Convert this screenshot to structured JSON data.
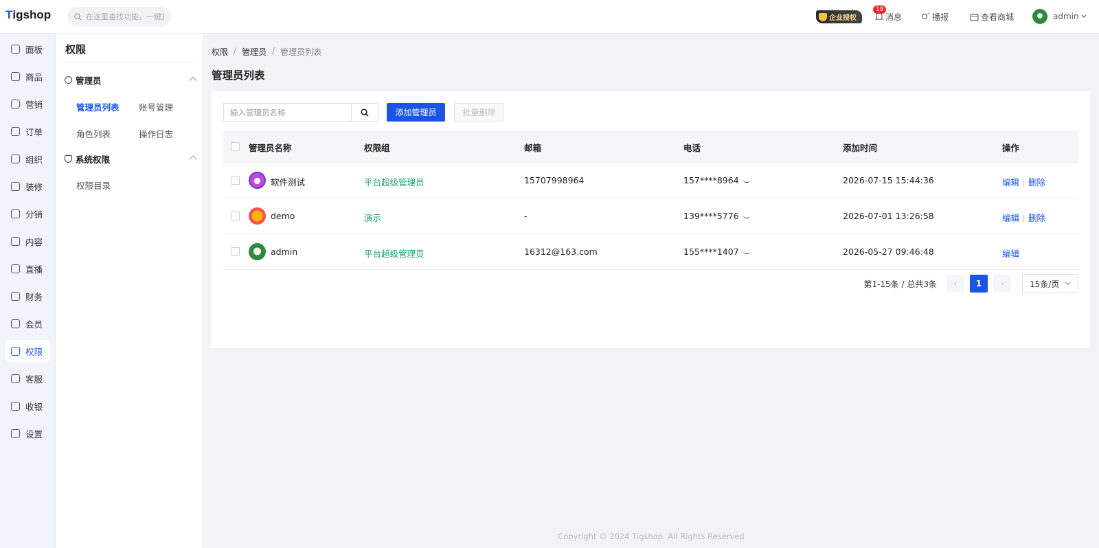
{
  "app": {
    "logo": "Tigshop",
    "search_placeholder": "在这里查找功能，一键直达"
  },
  "header": {
    "auth_badge": "企业授权",
    "notice_count": "19",
    "notice_label": "消息",
    "broadcast_label": "播报",
    "shop_label": "查看商城",
    "user": "admin"
  },
  "sidebar": {
    "items": [
      {
        "label": "面板",
        "icon": "chart-icon"
      },
      {
        "label": "商品",
        "icon": "box-icon"
      },
      {
        "label": "营销",
        "icon": "marketing-icon"
      },
      {
        "label": "订单",
        "icon": "order-icon"
      },
      {
        "label": "组织",
        "icon": "org-icon"
      },
      {
        "label": "装修",
        "icon": "decorate-icon"
      },
      {
        "label": "分销",
        "icon": "distribution-icon"
      },
      {
        "label": "内容",
        "icon": "content-icon"
      },
      {
        "label": "直播",
        "icon": "live-icon"
      },
      {
        "label": "财务",
        "icon": "finance-icon"
      },
      {
        "label": "会员",
        "icon": "member-icon"
      },
      {
        "label": "权限",
        "icon": "shield-icon"
      },
      {
        "label": "客服",
        "icon": "service-icon"
      },
      {
        "label": "收银",
        "icon": "cashier-icon"
      },
      {
        "label": "设置",
        "icon": "settings-icon"
      }
    ],
    "active": "权限"
  },
  "subnav": {
    "title": "权限",
    "groups": [
      {
        "label": "管理员",
        "links": [
          "管理员列表",
          "账号管理",
          "角色列表",
          "操作日志"
        ]
      },
      {
        "label": "系统权限",
        "links": [
          "权限目录"
        ]
      }
    ]
  },
  "breadcrumb": [
    "权限",
    "管理员",
    "管理员列表"
  ],
  "page_title": "管理员列表",
  "filter": {
    "placeholder": "输入管理员名称",
    "add_label": "添加管理员",
    "batch_delete_label": "批量删除"
  },
  "table": {
    "headers": [
      "管理员名称",
      "权限组",
      "邮箱",
      "电话",
      "添加时间",
      "操作"
    ],
    "rows": [
      {
        "name": "软件测试",
        "group": "平台超级管理员",
        "email": "15707998964",
        "phone": "157****8964",
        "time": "2026-07-15 15:44:36",
        "edit": "编辑",
        "delete": "删除"
      },
      {
        "name": "demo",
        "group": "演示",
        "email": "-",
        "phone": "139****5776",
        "time": "2026-07-01 13:26:58",
        "edit": "编辑",
        "delete": "删除"
      },
      {
        "name": "admin",
        "group": "平台超级管理员",
        "email": "16312@163.com",
        "phone": "155****1407",
        "time": "2026-05-27 09:46:48",
        "edit": "编辑",
        "delete": ""
      }
    ]
  },
  "pagination": {
    "summary": "第1-15条 / 总共3条",
    "page": "1",
    "page_size": "15条/页"
  },
  "footer": {
    "copyright": "Copyright © 2024 Tigshop. All Rights Reserved"
  }
}
